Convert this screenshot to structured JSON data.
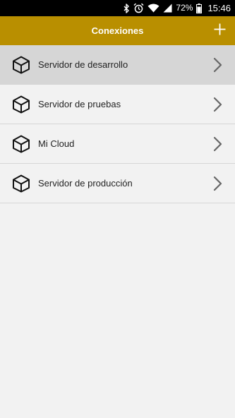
{
  "status_bar": {
    "battery_percent": "72%",
    "time": "15:46",
    "icons": [
      "bluetooth-icon",
      "alarm-icon",
      "wifi-icon",
      "signal-icon",
      "battery-icon"
    ]
  },
  "app_bar": {
    "title": "Conexiones",
    "add_icon": "plus-icon"
  },
  "connections": [
    {
      "label": "Servidor de desarrollo",
      "icon": "cube-icon",
      "selected": true
    },
    {
      "label": "Servidor de pruebas",
      "icon": "cube-icon",
      "selected": false
    },
    {
      "label": "Mi Cloud",
      "icon": "cube-icon",
      "selected": false
    },
    {
      "label": "Servidor de producción",
      "icon": "cube-icon",
      "selected": false
    }
  ],
  "colors": {
    "app_bar": "#b98f00",
    "background": "#f2f2f2",
    "selected_row": "#d6d6d6",
    "divider": "#d6d6d6"
  }
}
